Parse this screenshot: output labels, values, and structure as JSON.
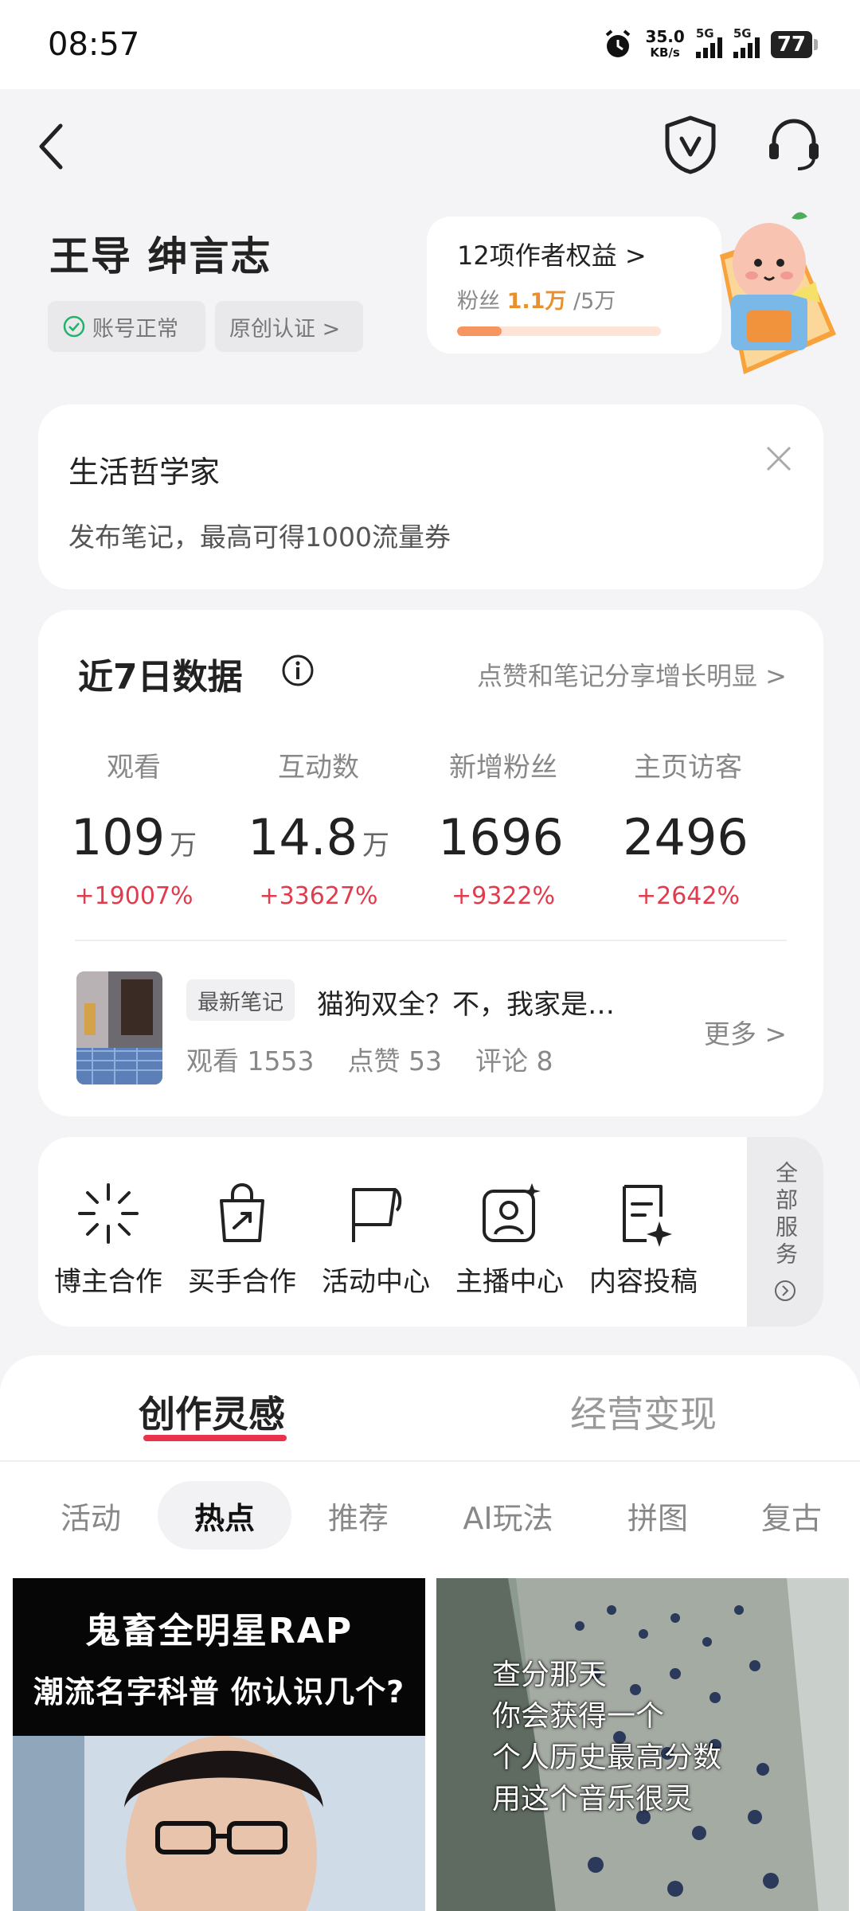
{
  "status_bar": {
    "time": "08:57",
    "net_speed_value": "35.0",
    "net_speed_unit": "KB/s",
    "signal1_label": "5G",
    "signal2_label": "5G",
    "battery": "77"
  },
  "profile": {
    "name": "王导 绅言志",
    "tag_status": "账号正常",
    "tag_original": "原创认证 >"
  },
  "creator_rights": {
    "title": "12项作者权益 >",
    "fans_label": "粉丝",
    "fans_current": "1.1万",
    "fans_target": "/5万",
    "progress_fraction": 0.22
  },
  "promo": {
    "title": "生活哲学家",
    "subtitle": "发布笔记，最高可得1000流量券"
  },
  "stats": {
    "title": "近7日数据",
    "hint": "点赞和笔记分享增长明显 >",
    "metrics": [
      {
        "label": "观看",
        "value": "109",
        "unit": "万",
        "change": "+19007%"
      },
      {
        "label": "互动数",
        "value": "14.8",
        "unit": "万",
        "change": "+33627%"
      },
      {
        "label": "新增粉丝",
        "value": "1696",
        "unit": "",
        "change": "+9322%"
      },
      {
        "label": "主页访客",
        "value": "2496",
        "unit": "",
        "change": "+2642%"
      }
    ],
    "latest_note": {
      "badge": "最新笔记",
      "title": "猫狗双全？不，我家是…",
      "views": "观看 1553",
      "likes": "点赞 53",
      "comments": "评论 8",
      "more": "更多 >"
    }
  },
  "services": {
    "items": [
      {
        "label": "博主合作"
      },
      {
        "label": "买手合作"
      },
      {
        "label": "活动中心"
      },
      {
        "label": "主播中心"
      },
      {
        "label": "内容投稿"
      }
    ],
    "all_label": "全部服务"
  },
  "bottom": {
    "main_tabs": [
      "创作灵感",
      "经营变现"
    ],
    "chips": [
      "活动",
      "热点",
      "推荐",
      "AI玩法",
      "拼图",
      "复古"
    ],
    "tile1": {
      "line1": "鬼畜全明星RAP",
      "line2": "潮流名字科普 你认识几个?"
    },
    "tile2": {
      "lines": [
        "查分那天",
        "你会获得一个",
        "个人历史最高分数",
        "用这个音乐很灵"
      ]
    }
  },
  "colors": {
    "accent_red": "#e23b4d",
    "tab_underline": "#e8334a",
    "progress": "#f6955f",
    "highlight_orange": "#e8902d"
  }
}
